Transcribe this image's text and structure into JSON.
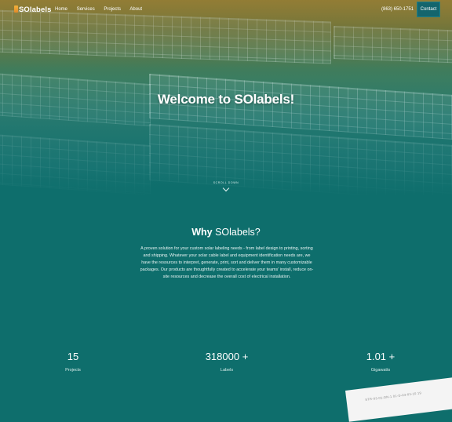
{
  "nav": {
    "logo_text": "SOlabels",
    "links": [
      "Home",
      "Services",
      "Projects",
      "About"
    ],
    "phone": "(863) 650-1751",
    "contact_label": "Contact"
  },
  "hero": {
    "title": "Welcome to SOlabels!",
    "scroll_label": "SCROLL DOWN"
  },
  "why": {
    "title_bold": "Why",
    "title_rest": " SOlabels?",
    "text": "A proven solution for your custom solar labeling needs - from label design to printing, sorting and shipping. Whatever your solar cable label and equipment identification needs are, we have the resources to interpret, generate, print, sort and deliver them in many customizable packages. Our products are thoughtfully created to accelerate your teams' install, reduce on-site resources and decrease the overall cost of electrical installation."
  },
  "stats": [
    {
      "value": "15",
      "label": "Projects"
    },
    {
      "value": "318000 +",
      "label": "Labels"
    },
    {
      "value": "1.01 +",
      "label": "Gigawatts"
    }
  ],
  "corner_text": "STR-03-01-DN-1    01-D-03-03-10  19",
  "colors": {
    "teal_bg": "#0e6e6c",
    "contact_bg": "#14656d",
    "logo_accent": "#f1b23a"
  }
}
